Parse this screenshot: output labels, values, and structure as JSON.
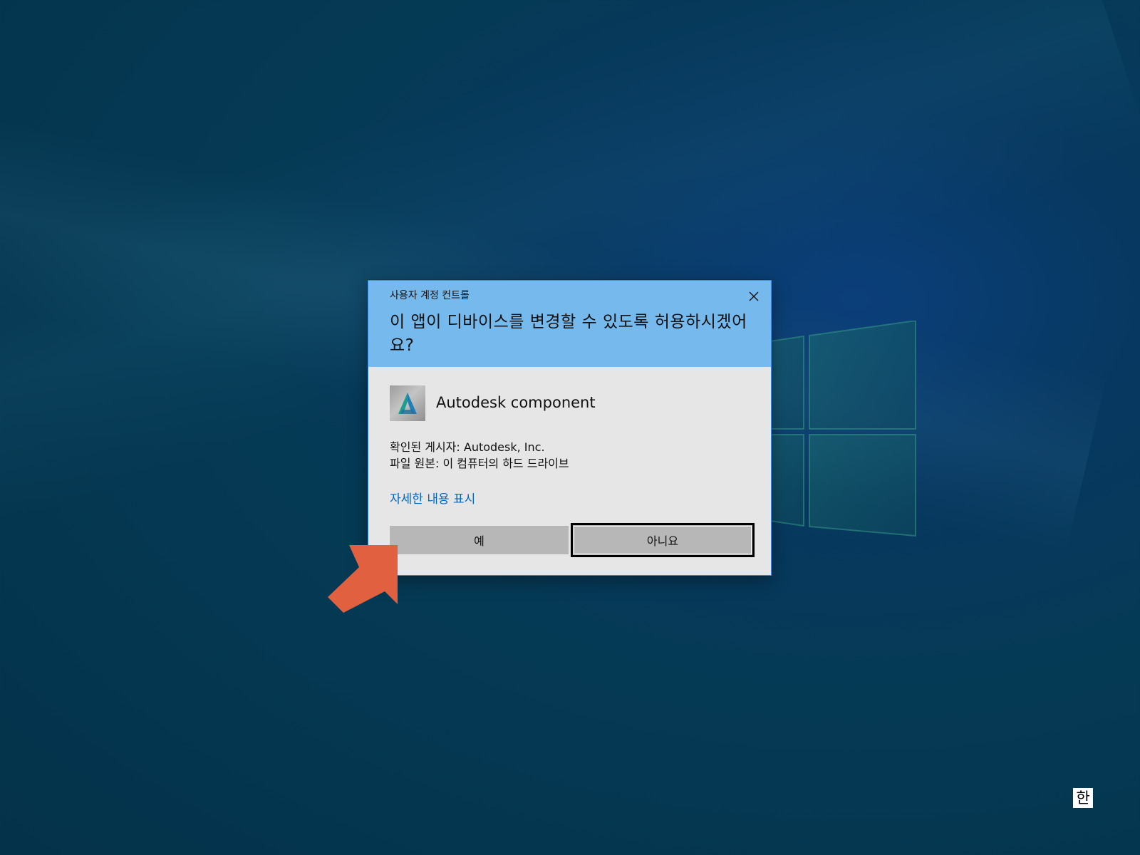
{
  "dialog": {
    "caption": "사용자 계정 컨트롤",
    "question": "이 앱이 디바이스를 변경할 수 있도록 허용하시겠어요?",
    "app_name": "Autodesk component",
    "app_icon": "autodesk-logo-icon",
    "publisher_line": "확인된 게시자: Autodesk, Inc.",
    "origin_line": "파일 원본: 이 컴퓨터의 하드 드라이브",
    "details_link": "자세한 내용 표시",
    "yes_label": "예",
    "no_label": "아니요",
    "header_color": "#76b9ed",
    "link_color": "#0067c0"
  },
  "annotation": {
    "arrow_icon": "pointer-arrow-icon",
    "arrow_color": "#e0603f"
  },
  "taskbar": {
    "ime_indicator": "한"
  }
}
